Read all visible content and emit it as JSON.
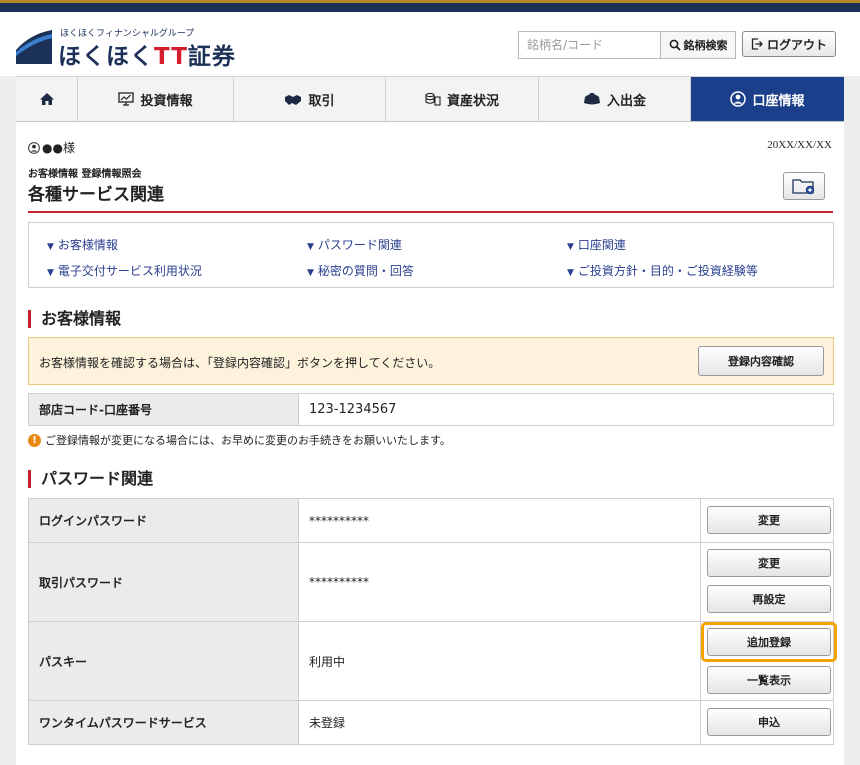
{
  "header": {
    "brand_group": "ほくほくフィナンシャルグループ",
    "brand_name_a": "ほくほく",
    "brand_name_b": "TT",
    "brand_name_c": "証券",
    "search_placeholder": "銘柄名/コード",
    "search_button": "銘柄検索",
    "logout_button": "ログアウト"
  },
  "nav": [
    {
      "label": "",
      "icon": "home-icon"
    },
    {
      "label": "投資情報",
      "icon": "chart-monitor-icon"
    },
    {
      "label": "取引",
      "icon": "handshake-icon"
    },
    {
      "label": "資産状況",
      "icon": "coins-icon"
    },
    {
      "label": "入出金",
      "icon": "wallet-icon"
    },
    {
      "label": "口座情報",
      "icon": "user-circle-icon",
      "active": true
    }
  ],
  "page": {
    "user_name": "●●様",
    "date": "20XX/XX/XX",
    "breadcrumb": "お客様情報 登録情報照会",
    "title": "各種サービス関連"
  },
  "anchors": [
    "お客様情報",
    "パスワード関連",
    "口座関連",
    "電子交付サービス利用状況",
    "秘密の質問・回答",
    "ご投資方針・目的・ご投資経験等"
  ],
  "customer_section": {
    "title": "お客様情報",
    "notice": "お客様情報を確認する場合は、「登録内容確認」ボタンを押してください。",
    "confirm_button": "登録内容確認",
    "account_label": "部店コード-口座番号",
    "account_value": "123-1234567",
    "caution": "ご登録情報が変更になる場合には、お早めに変更のお手続きをお願いいたします。"
  },
  "password_section": {
    "title": "パスワード関連",
    "rows": [
      {
        "label": "ログインパスワード",
        "value": "**********",
        "buttons": [
          "変更"
        ]
      },
      {
        "label": "取引パスワード",
        "value": "**********",
        "buttons": [
          "変更",
          "再設定"
        ]
      },
      {
        "label": "パスキー",
        "value": "利用中",
        "buttons": [
          "追加登録",
          "一覧表示"
        ]
      },
      {
        "label": "ワンタイムパスワードサービス",
        "value": "未登録",
        "buttons": [
          "申込"
        ]
      }
    ]
  },
  "colors": {
    "brand_navy": "#1c3158",
    "active_nav": "#1c3f8c",
    "accent_red": "#c8202b",
    "highlight_orange": "#f5a300",
    "notice_bg": "#fdf3dc"
  }
}
